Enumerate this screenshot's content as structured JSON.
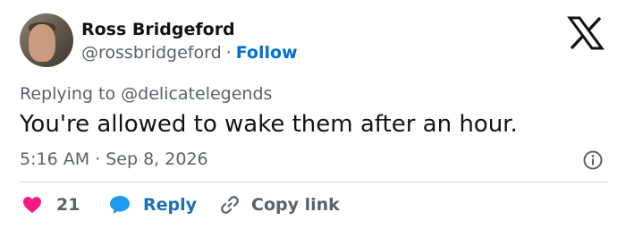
{
  "user": {
    "display_name": "Ross Bridgeford",
    "handle": "@rossbridgeford",
    "separator": "·",
    "follow_label": "Follow"
  },
  "tweet": {
    "replying_to": "Replying to @delicatelegends",
    "text": "You're allowed to wake them after an hour.",
    "timestamp": "5:16 AM · Sep 8, 2026"
  },
  "actions": {
    "like_count": "21",
    "reply_label": "Reply",
    "copy_link_label": "Copy link"
  },
  "icons": {
    "logo": "x-logo-icon",
    "info": "info-icon",
    "heart": "heart-icon",
    "reply": "speech-bubble-icon",
    "link": "link-icon"
  },
  "colors": {
    "text_primary": "#0f1419",
    "text_secondary": "#536471",
    "follow_link": "#006fd6",
    "heart": "#f91880",
    "reply": "#1d9bf0",
    "divider": "#cfd9de"
  }
}
